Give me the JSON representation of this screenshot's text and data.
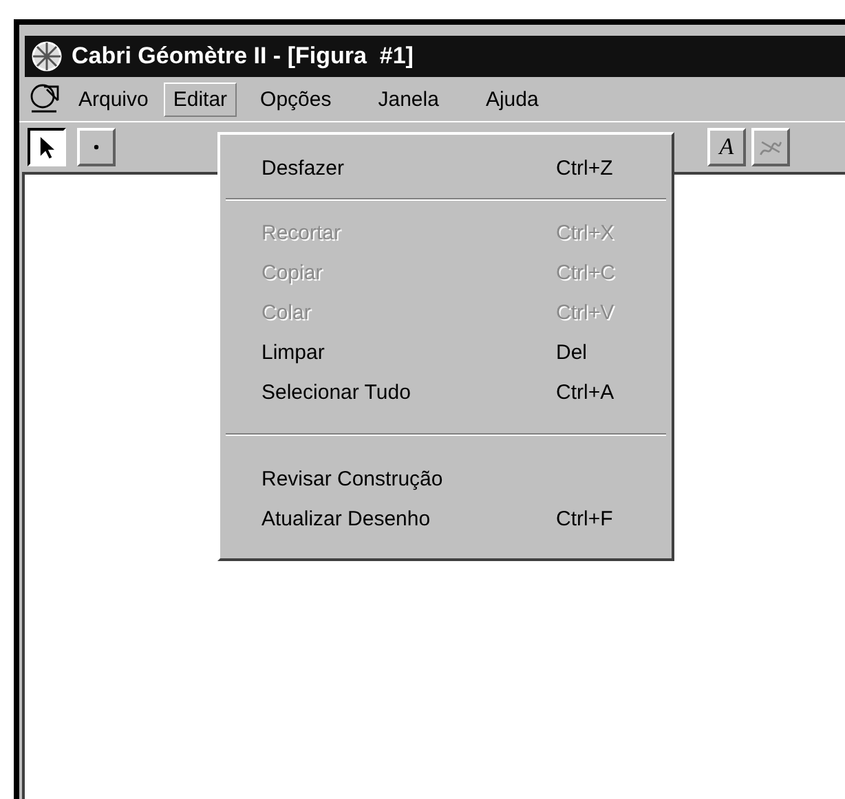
{
  "window": {
    "title": "Cabri Géomètre II - [Figura  #1]"
  },
  "menu_bar": [
    {
      "label": "Arquivo",
      "selected": false
    },
    {
      "label": "Editar",
      "selected": true
    },
    {
      "label": "Opções",
      "selected": false
    },
    {
      "label": "Janela",
      "selected": false
    },
    {
      "label": "Ajuda",
      "selected": false
    }
  ],
  "toolbar": {
    "left_tools": [
      {
        "kind": "pointer",
        "selected": true
      },
      {
        "kind": "point",
        "selected": false
      }
    ],
    "right_tools": [
      {
        "kind": "text",
        "label": "A",
        "selected": false
      },
      {
        "kind": "scribble",
        "selected": false
      }
    ]
  },
  "edit_menu": {
    "items": [
      {
        "kind": "command",
        "label": "Desfazer",
        "shortcut": "Ctrl+Z",
        "disabled": false
      },
      {
        "kind": "separator"
      },
      {
        "kind": "command",
        "label": "Recortar",
        "shortcut": "Ctrl+X",
        "disabled": true
      },
      {
        "kind": "command",
        "label": "Copiar",
        "shortcut": "Ctrl+C",
        "disabled": true
      },
      {
        "kind": "command",
        "label": "Colar",
        "shortcut": "Ctrl+V",
        "disabled": true
      },
      {
        "kind": "command",
        "label": "Limpar",
        "shortcut": "Del",
        "disabled": false
      },
      {
        "kind": "command",
        "label": "Selecionar Tudo",
        "shortcut": "Ctrl+A",
        "disabled": false
      },
      {
        "kind": "separator"
      },
      {
        "kind": "command",
        "label": "Revisar Construção",
        "disabled": false
      },
      {
        "kind": "command",
        "label": "Atualizar Desenho",
        "shortcut": "Ctrl+F",
        "disabled": false
      }
    ]
  }
}
